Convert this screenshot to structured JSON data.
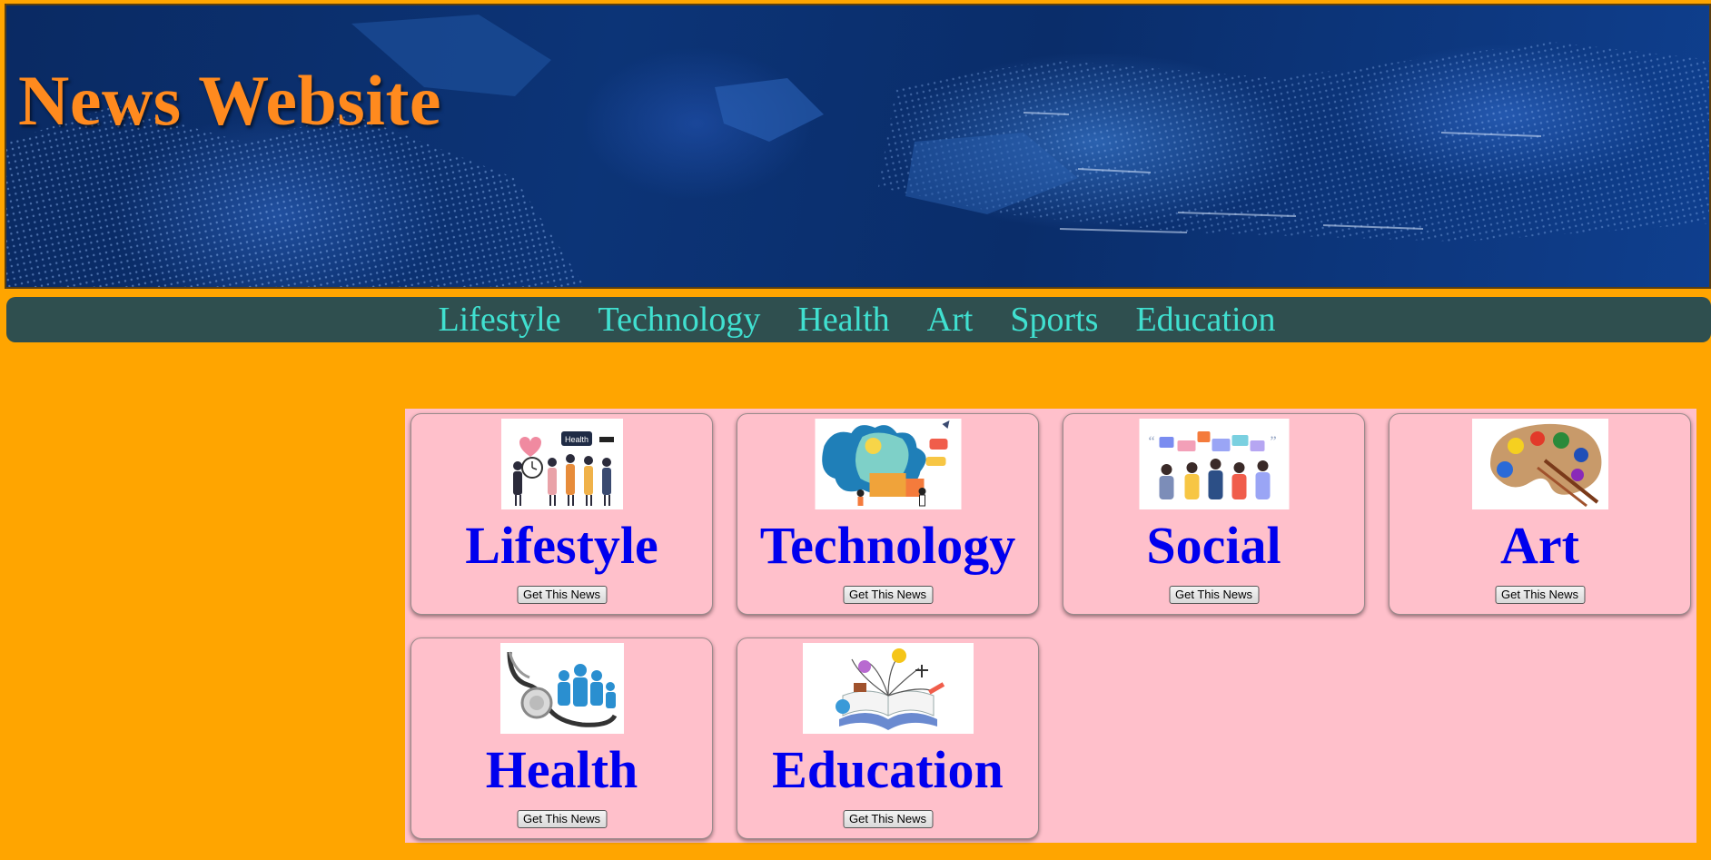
{
  "header": {
    "title": "News Website",
    "title_color": "#ff8a1e"
  },
  "nav": {
    "items": [
      {
        "label": "Lifestyle"
      },
      {
        "label": "Technology"
      },
      {
        "label": "Health"
      },
      {
        "label": "Art"
      },
      {
        "label": "Sports"
      },
      {
        "label": "Education"
      }
    ],
    "background": "#2f4f4f",
    "link_color": "#40e0d0"
  },
  "cards": [
    {
      "title": "Lifestyle",
      "button_label": "Get This News",
      "image": "lifestyle-illustration"
    },
    {
      "title": "Technology",
      "button_label": "Get This News",
      "image": "technology-illustration"
    },
    {
      "title": "Social",
      "button_label": "Get This News",
      "image": "social-illustration"
    },
    {
      "title": "Art",
      "button_label": "Get This News",
      "image": "art-palette-illustration"
    },
    {
      "title": "Health",
      "button_label": "Get This News",
      "image": "health-stethoscope-illustration"
    },
    {
      "title": "Education",
      "button_label": "Get This News",
      "image": "education-book-illustration"
    }
  ],
  "colors": {
    "page_background": "#ffa500",
    "cards_background": "#ffc0cb",
    "card_title": "#0000ee"
  }
}
